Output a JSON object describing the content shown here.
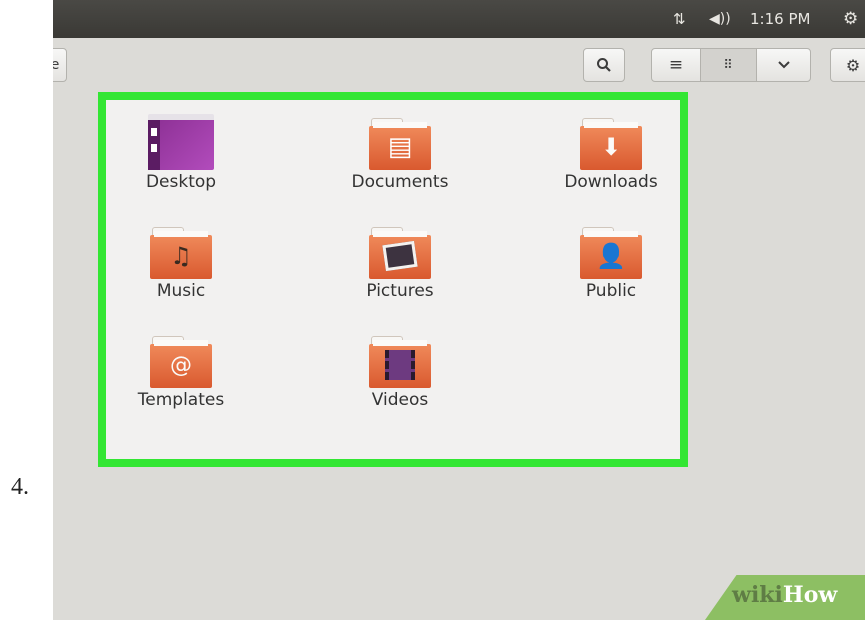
{
  "step_number": "4.",
  "top_panel": {
    "network_icon": "network-updown-icon",
    "volume_icon": "volume-icon",
    "clock": "1:16 PM",
    "power_icon": "power-gear-icon"
  },
  "toolbar": {
    "back_glyph": "e",
    "search_icon": "search-icon",
    "list_view_icon": "list-view-icon",
    "grid_view_icon": "grid-view-icon",
    "dropdown_icon": "chevron-down-icon",
    "settings_icon": "gear-icon"
  },
  "folders": [
    {
      "label": "Desktop",
      "icon": "desktop-icon"
    },
    {
      "label": "Documents",
      "icon": "documents-folder-icon"
    },
    {
      "label": "Downloads",
      "icon": "downloads-folder-icon"
    },
    {
      "label": "Music",
      "icon": "music-folder-icon"
    },
    {
      "label": "Pictures",
      "icon": "pictures-folder-icon"
    },
    {
      "label": "Public",
      "icon": "public-folder-icon"
    },
    {
      "label": "Templates",
      "icon": "templates-folder-icon"
    },
    {
      "label": "Videos",
      "icon": "videos-folder-icon"
    }
  ],
  "highlight_color": "#33e633",
  "watermark": {
    "part1": "wiki",
    "part2": "How"
  }
}
